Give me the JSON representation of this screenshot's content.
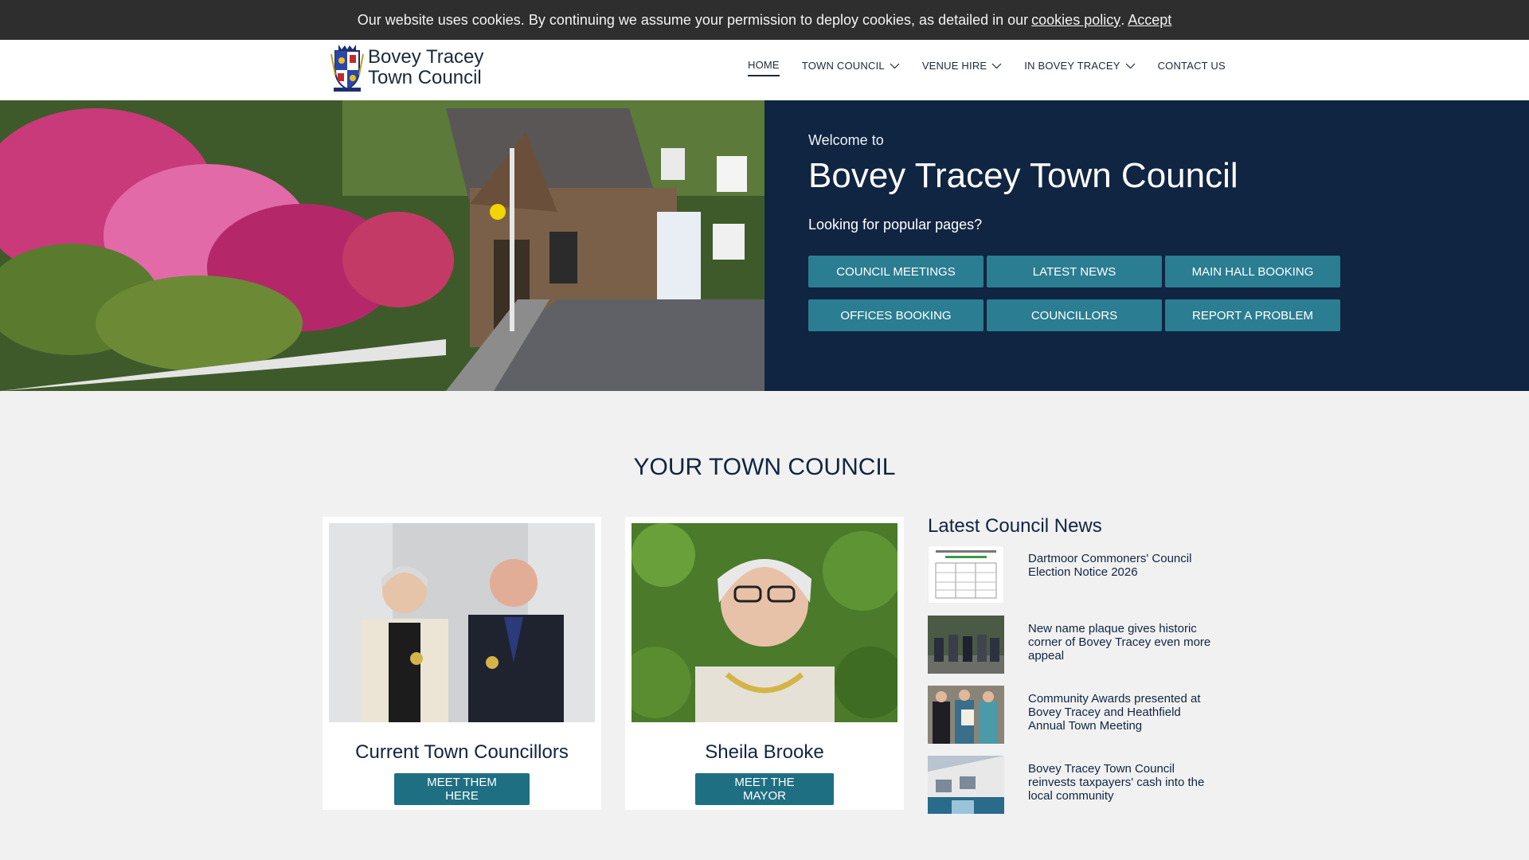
{
  "cookie_bar": {
    "message": "Our website uses cookies. By continuing we assume your permission to deploy cookies, as detailed in our",
    "policy_link": "cookies policy",
    "separator": ".",
    "accept_link": "Accept"
  },
  "header": {
    "logo_line1": "Bovey Tracey",
    "logo_line2": "Town Council",
    "nav": [
      {
        "label": "HOME",
        "active": true
      },
      {
        "label": "TOWN COUNCIL",
        "dropdown": true
      },
      {
        "label": "VENUE HIRE",
        "dropdown": true
      },
      {
        "label": "IN BOVEY TRACEY",
        "dropdown": true
      },
      {
        "label": "CONTACT US"
      }
    ]
  },
  "hero": {
    "welcome": "Welcome to",
    "title": "Bovey Tracey Town Council",
    "popular": "Looking for popular pages?",
    "buttons": [
      "COUNCIL MEETINGS",
      "LATEST NEWS",
      "MAIN HALL BOOKING",
      "OFFICES BOOKING",
      "COUNCILLORS",
      "REPORT A PROBLEM"
    ]
  },
  "section": {
    "title": "YOUR TOWN COUNCIL",
    "cards": [
      {
        "name": "Current Town Councillors",
        "button": "MEET THEM HERE"
      },
      {
        "name": "Sheila Brooke",
        "button": "MEET THE MAYOR"
      }
    ]
  },
  "news": {
    "title": "Latest Council News",
    "items": [
      "Dartmoor Commoners' Council Election Notice 2026",
      "New name plaque gives historic corner of Bovey Tracey even more appeal",
      "Community Awards presented at Bovey Tracey and Heathfield Annual Town Meeting",
      "Bovey Tracey Town Council reinvests taxpayers' cash into the local community"
    ]
  },
  "colors": {
    "navy": "#102542",
    "teal_button": "#2b7d91",
    "cookie_bar": "#2e2e2e"
  }
}
